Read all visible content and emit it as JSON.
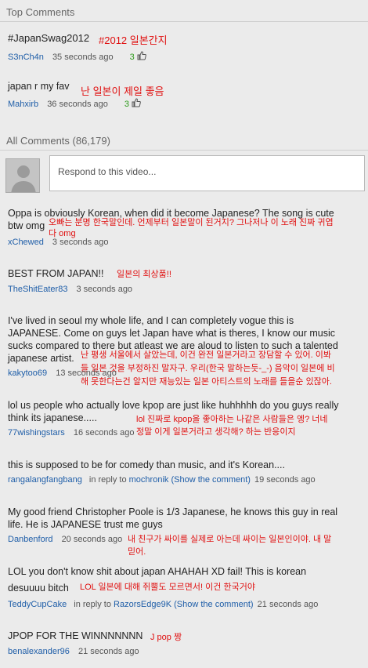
{
  "top_comments": {
    "header": "Top Comments",
    "items": [
      {
        "text": "#JapanSwag2012",
        "translation": "#2012 일본간지",
        "user": "S3nCh4n",
        "time": "35 seconds ago",
        "votes": "3"
      },
      {
        "text": "japan r my fav",
        "translation": "난 일본이 제일 좋음",
        "user": "Mahxirb",
        "time": "36 seconds ago",
        "votes": "3"
      }
    ]
  },
  "all_comments": {
    "header": "All Comments (86,179)",
    "reply_placeholder": "Respond to this video...",
    "items": [
      {
        "text_1": "Oppa is obviously Korean, when did it become Japanese? The song is cute",
        "text_2": "btw omg",
        "translation_1": "오빠는 분명 한국말인데. 언제부터 일본말이 된거지? 그나저나 이 노래 진짜 귀엽",
        "translation_2": "다 omg",
        "user": "xChewed",
        "time": "3 seconds ago"
      },
      {
        "text": "BEST FROM JAPAN!!",
        "translation": "일본의 최상품!!",
        "user": "TheShitEater83",
        "time": "3 seconds ago"
      },
      {
        "text_1": "I've lived in seoul my whole life, and I can completely vogue this is",
        "text_2": "JAPANESE. Come on guys let Japan have what is theres, I know our music",
        "text_3": "sucks compared to there but atleast we are aloud to listen to such a talented",
        "text_4": "japanese artist.",
        "translation_1": "난 평생 서울에서 살았는데, 이건 완전 일본거라고 장담할 수 있어. 이봐",
        "translation_2": "들 일본 것을 부정하진 말자구. 우리(한국 말하는듯-_-) 음악이 일본에 비",
        "translation_3": "해 못한다는건 알지만 재능있는 일본 아티스트의 노래를 들을순 있잖아.",
        "user": "kakytoo69",
        "time": "13 seconds ago"
      },
      {
        "text_1": "lol us people who actually love kpop are just like huhhhhh do you guys really",
        "text_2": "think its japanese.....",
        "translation_1": "lol 진짜로 kpop을 좋아하는 나같은 사람들은 엥? 너네",
        "translation_2": "정말 이게 일본거라고 생각해? 하는 반응이지",
        "user": "77wishingstars",
        "time": "16 seconds ago"
      },
      {
        "text": "this is supposed to be for comedy than music, and it's Korean....",
        "user": "rangalangfangbang",
        "in_reply_to": "in reply to",
        "reply_user": "mochronik",
        "show_comment": "(Show the comment)",
        "time": "19 seconds ago"
      },
      {
        "text_1": "My good friend Christopher Poole is 1/3 Japanese, he knows this guy in real",
        "text_2": "life. He is JAPANESE trust me guys",
        "translation_1": "내 친구가 싸이를 실제로 아는데 싸이는 일본인이야. 내 말",
        "translation_2": "믿어.",
        "user": "Danbenford",
        "time": "20 seconds ago"
      },
      {
        "text_1": "LOL you don't know shit about japan AHAHAH XD fail! This is korean",
        "text_2": "desuuuu bitch",
        "translation": "LOL 일본에 대해 쥐뿔도 모르면서! 이건 한국거야",
        "user": "TeddyCupCake",
        "in_reply_to": "in reply to",
        "reply_user": "RazorsEdge9K",
        "show_comment": "(Show the comment)",
        "time": "21 seconds ago"
      },
      {
        "text": "JPOP FOR THE WINNNNNNN",
        "translation": "J pop 짱",
        "user": "benalexander96",
        "time": "21 seconds ago"
      }
    ]
  },
  "colors": {
    "background": "#ebebeb",
    "username": "#1f5ea8",
    "translation": "#e01010",
    "vote": "#2e9b1c"
  },
  "icons": {
    "thumbs_up": "thumbs-up-icon",
    "avatar": "default-avatar"
  }
}
